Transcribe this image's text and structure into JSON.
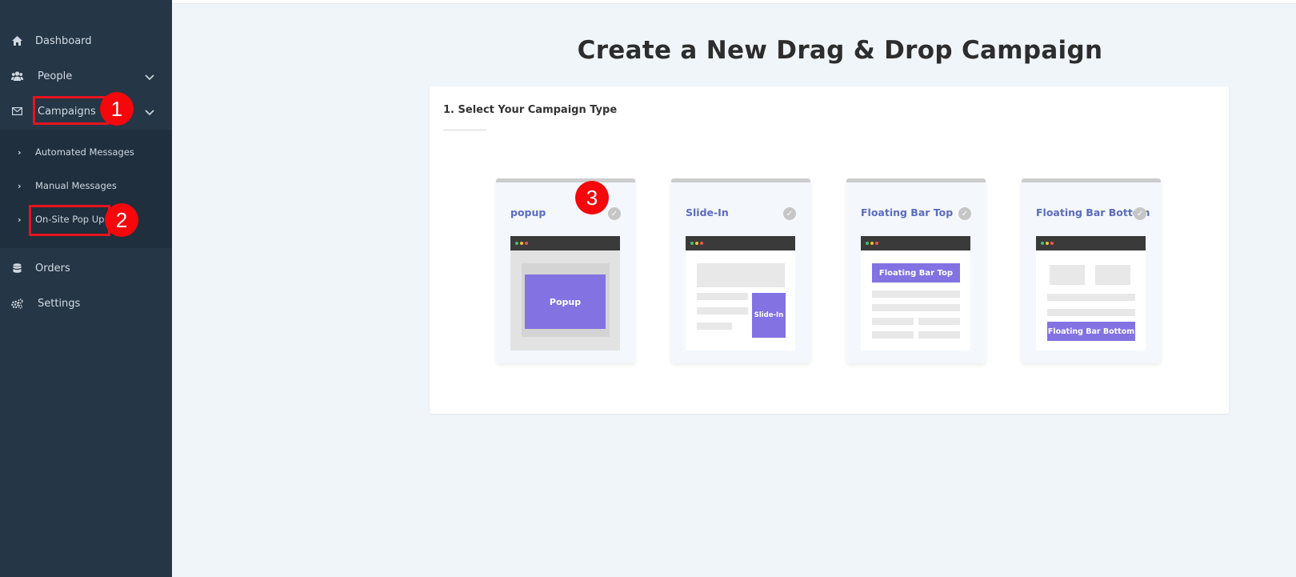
{
  "sidebar": {
    "dashboard": "Dashboard",
    "people": "People",
    "campaigns": "Campaigns",
    "submenu": {
      "automated": "Automated Messages",
      "manual": "Manual Messages",
      "onsite": "On-Site Pop Up"
    },
    "orders": "Orders",
    "settings": "Settings"
  },
  "main": {
    "title": "Create a New Drag & Drop Campaign",
    "section_heading": "1. Select Your Campaign Type",
    "cards": [
      {
        "title": "popup",
        "preview_label": "Popup"
      },
      {
        "title": "Slide-In",
        "preview_label": "Slide-In"
      },
      {
        "title": "Floating Bar Top",
        "preview_label": "Floating Bar Top"
      },
      {
        "title": "Floating Bar Bottom",
        "preview_label": "Floating Bar Bottom"
      }
    ]
  },
  "annotations": {
    "badge_1": "1",
    "badge_2": "2",
    "badge_3": "3"
  },
  "colors": {
    "sidebar_bg": "#253646",
    "accent_purple": "#8372e2",
    "card_title": "#5b6bc0",
    "annotation_red": "#f5070c"
  }
}
